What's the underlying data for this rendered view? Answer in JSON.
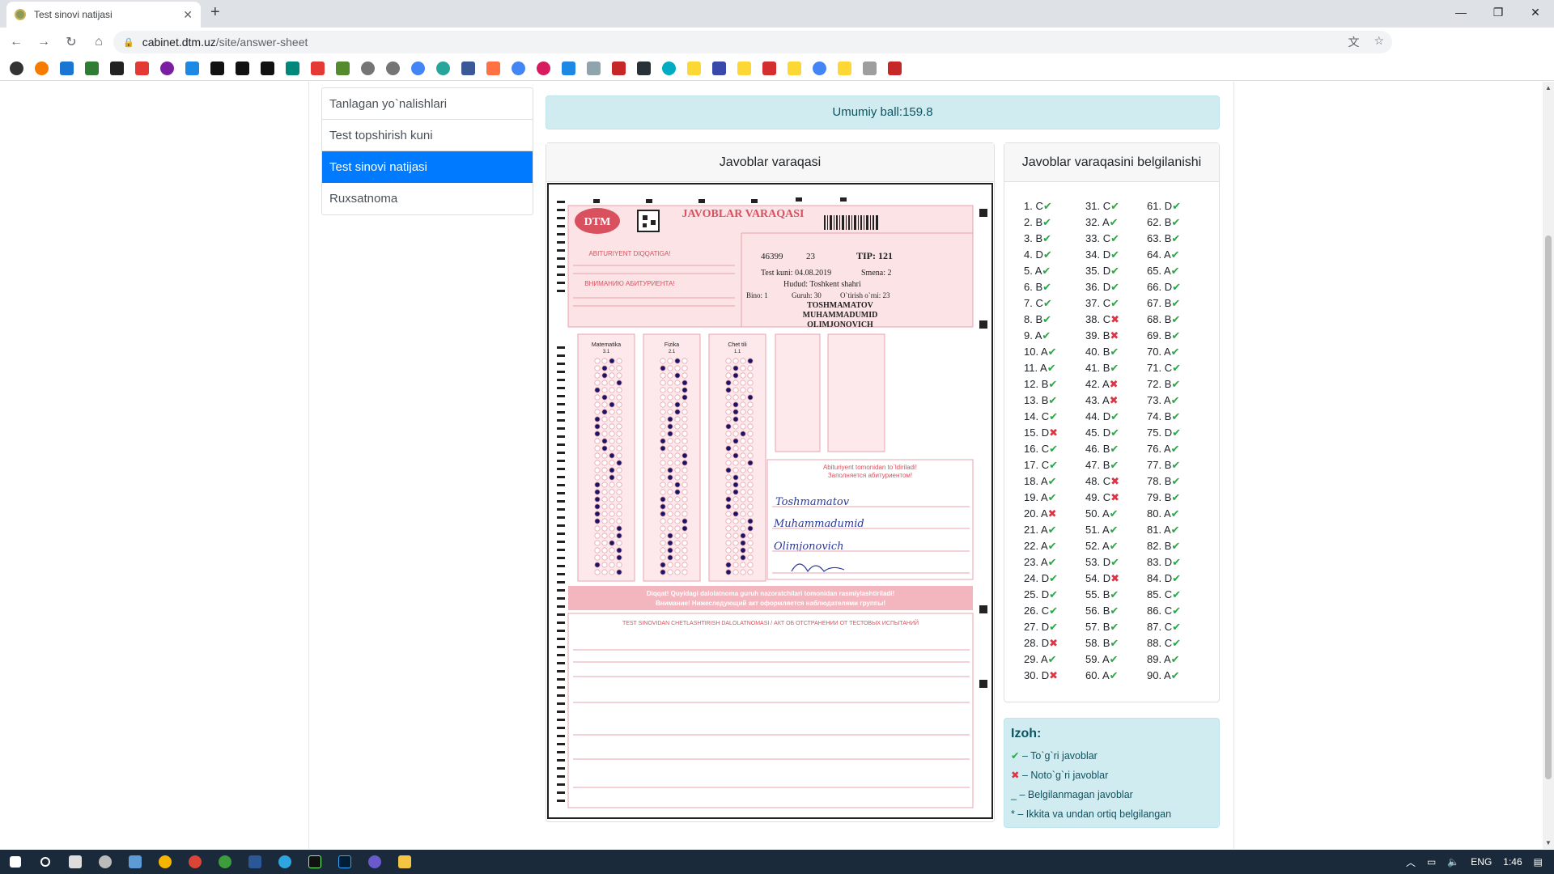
{
  "browser": {
    "tab_title": "Test sinovi natijasi",
    "url_host": "cabinet.dtm.uz",
    "url_path": "/site/answer-sheet"
  },
  "menu": {
    "items": [
      {
        "label": "Tanlagan yo`nalishlari",
        "active": false
      },
      {
        "label": "Test topshirish kuni",
        "active": false
      },
      {
        "label": "Test sinovi natijasi",
        "active": true
      },
      {
        "label": "Ruxsatnoma",
        "active": false
      }
    ]
  },
  "score": {
    "label": "Umumiy ball:",
    "value": "159.8"
  },
  "sheet_card": {
    "header": "Javoblar varaqasi",
    "sheet": {
      "brand": "DTM",
      "title": "JAVOBLAR VARAQASI",
      "attention_uz": "ABITURIYENT DIQQATIGA!",
      "attention_ru": "ВНИМАНИЮ АБИТУРИЕНТА!",
      "id": "46399",
      "code": "23",
      "tip": "TIP: 121",
      "test_kuni": "Test kuni: 04.08.2019",
      "smena": "Smena: 2",
      "hudud": "Hudud: Toshkent shahri",
      "bino": "Bino: 1",
      "guruh": "Guruh: 30",
      "orin": "O`tirish o`rni: 23",
      "name1": "TOSHMAMATOV",
      "name2": "MUHAMMADUMID",
      "name3": "OLIMJONOVICH",
      "subjects": [
        "Matematika",
        "Fizika",
        "Chet tili"
      ],
      "subject_codes": [
        "3.1",
        "2.1",
        "1.1"
      ],
      "sign_header": "Abituriyent tomonidan to`ldiriladi!",
      "sign_header_ru": "Заполняется абитуриентом!",
      "hand1": "Toshmamatov",
      "hand2": "Muhammadumid",
      "hand3": "Olimjonovich",
      "warning_uz": "Diqqat! Quyidagi dalolatnoma guruh nazoratchilari tomonidan rasmiylashtiriladi!",
      "warning_ru": "Внимание! Нижеследующий акт оформляется наблюдателями группы!",
      "act_title": "TEST SINOVIDAN CHETLASHTIRISH DALOLATNOMASI / АКТ ОБ ОТСТРАНЕНИИ ОТ ТЕСТОВЫХ ИСПЫТАНИЙ"
    }
  },
  "mark_card": {
    "header": "Javoblar varaqasini belgilanishi",
    "answers": [
      {
        "n": "1.",
        "a": "C",
        "ok": true
      },
      {
        "n": "2.",
        "a": "B",
        "ok": true
      },
      {
        "n": "3.",
        "a": "B",
        "ok": true
      },
      {
        "n": "4.",
        "a": "D",
        "ok": true
      },
      {
        "n": "5.",
        "a": "A",
        "ok": true
      },
      {
        "n": "6.",
        "a": "B",
        "ok": true
      },
      {
        "n": "7.",
        "a": "C",
        "ok": true
      },
      {
        "n": "8.",
        "a": "B",
        "ok": true
      },
      {
        "n": "9.",
        "a": "A",
        "ok": true
      },
      {
        "n": "10.",
        "a": "A",
        "ok": true
      },
      {
        "n": "11.",
        "a": "A",
        "ok": true
      },
      {
        "n": "12.",
        "a": "B",
        "ok": true
      },
      {
        "n": "13.",
        "a": "B",
        "ok": true
      },
      {
        "n": "14.",
        "a": "C",
        "ok": true
      },
      {
        "n": "15.",
        "a": "D",
        "ok": false
      },
      {
        "n": "16.",
        "a": "C",
        "ok": true
      },
      {
        "n": "17.",
        "a": "C",
        "ok": true
      },
      {
        "n": "18.",
        "a": "A",
        "ok": true
      },
      {
        "n": "19.",
        "a": "A",
        "ok": true
      },
      {
        "n": "20.",
        "a": "A",
        "ok": false
      },
      {
        "n": "21.",
        "a": "A",
        "ok": true
      },
      {
        "n": "22.",
        "a": "A",
        "ok": true
      },
      {
        "n": "23.",
        "a": "A",
        "ok": true
      },
      {
        "n": "24.",
        "a": "D",
        "ok": true
      },
      {
        "n": "25.",
        "a": "D",
        "ok": true
      },
      {
        "n": "26.",
        "a": "C",
        "ok": true
      },
      {
        "n": "27.",
        "a": "D",
        "ok": true
      },
      {
        "n": "28.",
        "a": "D",
        "ok": false
      },
      {
        "n": "29.",
        "a": "A",
        "ok": true
      },
      {
        "n": "30.",
        "a": "D",
        "ok": false
      },
      {
        "n": "31.",
        "a": "C",
        "ok": true
      },
      {
        "n": "32.",
        "a": "A",
        "ok": true
      },
      {
        "n": "33.",
        "a": "C",
        "ok": true
      },
      {
        "n": "34.",
        "a": "D",
        "ok": true
      },
      {
        "n": "35.",
        "a": "D",
        "ok": true
      },
      {
        "n": "36.",
        "a": "D",
        "ok": true
      },
      {
        "n": "37.",
        "a": "C",
        "ok": true
      },
      {
        "n": "38.",
        "a": "C",
        "ok": false
      },
      {
        "n": "39.",
        "a": "B",
        "ok": false
      },
      {
        "n": "40.",
        "a": "B",
        "ok": true
      },
      {
        "n": "41.",
        "a": "B",
        "ok": true
      },
      {
        "n": "42.",
        "a": "A",
        "ok": false
      },
      {
        "n": "43.",
        "a": "A",
        "ok": false
      },
      {
        "n": "44.",
        "a": "D",
        "ok": true
      },
      {
        "n": "45.",
        "a": "D",
        "ok": true
      },
      {
        "n": "46.",
        "a": "B",
        "ok": true
      },
      {
        "n": "47.",
        "a": "B",
        "ok": true
      },
      {
        "n": "48.",
        "a": "C",
        "ok": false
      },
      {
        "n": "49.",
        "a": "C",
        "ok": false
      },
      {
        "n": "50.",
        "a": "A",
        "ok": true
      },
      {
        "n": "51.",
        "a": "A",
        "ok": true
      },
      {
        "n": "52.",
        "a": "A",
        "ok": true
      },
      {
        "n": "53.",
        "a": "D",
        "ok": true
      },
      {
        "n": "54.",
        "a": "D",
        "ok": false
      },
      {
        "n": "55.",
        "a": "B",
        "ok": true
      },
      {
        "n": "56.",
        "a": "B",
        "ok": true
      },
      {
        "n": "57.",
        "a": "B",
        "ok": true
      },
      {
        "n": "58.",
        "a": "B",
        "ok": true
      },
      {
        "n": "59.",
        "a": "A",
        "ok": true
      },
      {
        "n": "60.",
        "a": "A",
        "ok": true
      },
      {
        "n": "61.",
        "a": "D",
        "ok": true
      },
      {
        "n": "62.",
        "a": "B",
        "ok": true
      },
      {
        "n": "63.",
        "a": "B",
        "ok": true
      },
      {
        "n": "64.",
        "a": "A",
        "ok": true
      },
      {
        "n": "65.",
        "a": "A",
        "ok": true
      },
      {
        "n": "66.",
        "a": "D",
        "ok": true
      },
      {
        "n": "67.",
        "a": "B",
        "ok": true
      },
      {
        "n": "68.",
        "a": "B",
        "ok": true
      },
      {
        "n": "69.",
        "a": "B",
        "ok": true
      },
      {
        "n": "70.",
        "a": "A",
        "ok": true
      },
      {
        "n": "71.",
        "a": "C",
        "ok": true
      },
      {
        "n": "72.",
        "a": "B",
        "ok": true
      },
      {
        "n": "73.",
        "a": "A",
        "ok": true
      },
      {
        "n": "74.",
        "a": "B",
        "ok": true
      },
      {
        "n": "75.",
        "a": "D",
        "ok": true
      },
      {
        "n": "76.",
        "a": "A",
        "ok": true
      },
      {
        "n": "77.",
        "a": "B",
        "ok": true
      },
      {
        "n": "78.",
        "a": "B",
        "ok": true
      },
      {
        "n": "79.",
        "a": "B",
        "ok": true
      },
      {
        "n": "80.",
        "a": "A",
        "ok": true
      },
      {
        "n": "81.",
        "a": "A",
        "ok": true
      },
      {
        "n": "82.",
        "a": "B",
        "ok": true
      },
      {
        "n": "83.",
        "a": "D",
        "ok": true
      },
      {
        "n": "84.",
        "a": "D",
        "ok": true
      },
      {
        "n": "85.",
        "a": "C",
        "ok": true
      },
      {
        "n": "86.",
        "a": "C",
        "ok": true
      },
      {
        "n": "87.",
        "a": "C",
        "ok": true
      },
      {
        "n": "88.",
        "a": "C",
        "ok": true
      },
      {
        "n": "89.",
        "a": "A",
        "ok": true
      },
      {
        "n": "90.",
        "a": "A",
        "ok": true
      }
    ]
  },
  "legend": {
    "title": "Izoh:",
    "items": [
      {
        "sym": "✔",
        "text": "– To`g`ri javoblar",
        "color": "#28a745"
      },
      {
        "sym": "✖",
        "text": "– Noto`g`ri javoblar",
        "color": "#dc3545"
      },
      {
        "sym": "_",
        "text": "– Belgilanmagan javoblar",
        "color": "#212529"
      },
      {
        "sym": "*",
        "text": "– Ikkita va undan ortiq belgilangan",
        "color": "#212529"
      }
    ]
  },
  "taskbar": {
    "lang": "ENG",
    "time": "1:46"
  },
  "colors": {
    "accent": "#007bff",
    "info_bg": "#d1ecf1",
    "info_text": "#0c5460",
    "ok": "#28a745",
    "bad": "#dc3545",
    "sheet_pink": "#f4c6cc"
  }
}
